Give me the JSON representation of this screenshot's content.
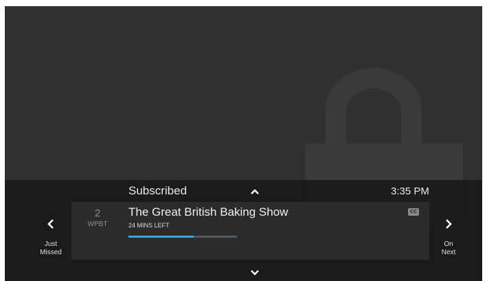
{
  "guide": {
    "category": "Subscribed",
    "clock": "3:35 PM"
  },
  "channel": {
    "number": "2",
    "callsign": "WPBT"
  },
  "program": {
    "title": "The Great British Baking Show",
    "time_left": "24 MINS LEFT",
    "progress_fraction": 0.6,
    "closed_captions": "CC"
  },
  "nav": {
    "prev_label_1": "Just",
    "prev_label_2": "Missed",
    "next_label_1": "On",
    "next_label_2": "Next"
  },
  "icons": {
    "background": "lock-icon",
    "up": "chevron-up-icon",
    "down": "chevron-down-icon",
    "prev": "chevron-left-icon",
    "next": "chevron-right-icon",
    "captions": "closed-captions-icon"
  },
  "colors": {
    "progress": "#3aa6e0",
    "progress_track": "#4a5a66",
    "background": "#303030"
  }
}
